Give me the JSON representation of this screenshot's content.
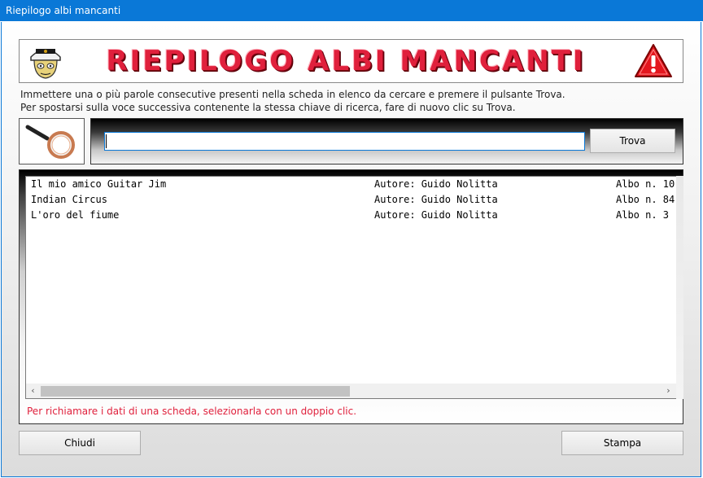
{
  "window": {
    "title": "Riepilogo albi mancanti"
  },
  "banner": {
    "title": "RIEPILOGO ALBI MANCANTI"
  },
  "instructions": {
    "line1": "Immettere una o più parole consecutive presenti nella scheda in elenco da cercare e premere il pulsante Trova.",
    "line2": "Per spostarsi sulla voce successiva contenente la stessa chiave di ricerca, fare di nuovo clic su Trova."
  },
  "search": {
    "value": "",
    "button_label": "Trova"
  },
  "list": {
    "rows": [
      {
        "title": "Il mio amico Guitar Jim",
        "author": "Autore: Guido Nolitta",
        "issue": "Albo n. 10"
      },
      {
        "title": "Indian Circus",
        "author": "Autore: Guido Nolitta",
        "issue": "Albo n. 84"
      },
      {
        "title": "L'oro del fiume",
        "author": "Autore: Guido Nolitta",
        "issue": "Albo n. 3"
      }
    ],
    "scroll_left": "‹",
    "scroll_right": "›"
  },
  "hint": "Per richiamare i dati di una scheda, selezionarla con un doppio clic.",
  "buttons": {
    "close_label": "Chiudi",
    "print_label": "Stampa"
  }
}
